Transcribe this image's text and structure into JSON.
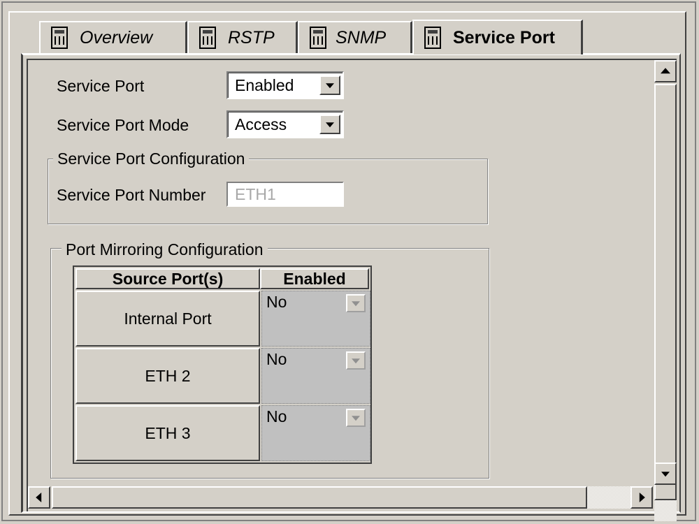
{
  "tabs": [
    {
      "label": "Overview",
      "active": false
    },
    {
      "label": "RSTP",
      "active": false
    },
    {
      "label": "SNMP",
      "active": false
    },
    {
      "label": "Service Port",
      "active": true
    }
  ],
  "form": {
    "service_port": {
      "label": "Service Port",
      "value": "Enabled"
    },
    "service_port_mode": {
      "label": "Service Port Mode",
      "value": "Access"
    }
  },
  "service_port_config": {
    "title": "Service Port Configuration",
    "number_label": "Service Port Number",
    "number_value": "ETH1"
  },
  "port_mirroring": {
    "title": "Port Mirroring Configuration",
    "columns": [
      "Source Port(s)",
      "Enabled"
    ],
    "rows": [
      {
        "port": "Internal Port",
        "enabled": "No"
      },
      {
        "port": "ETH 2",
        "enabled": "No"
      },
      {
        "port": "ETH 3",
        "enabled": "No"
      }
    ]
  },
  "icons": {
    "tab": "device-icon",
    "dropdown": "chevron-down-icon",
    "scroll_up": "arrow-up-icon",
    "scroll_down": "arrow-down-icon",
    "scroll_left": "arrow-left-icon",
    "scroll_right": "arrow-right-icon"
  }
}
